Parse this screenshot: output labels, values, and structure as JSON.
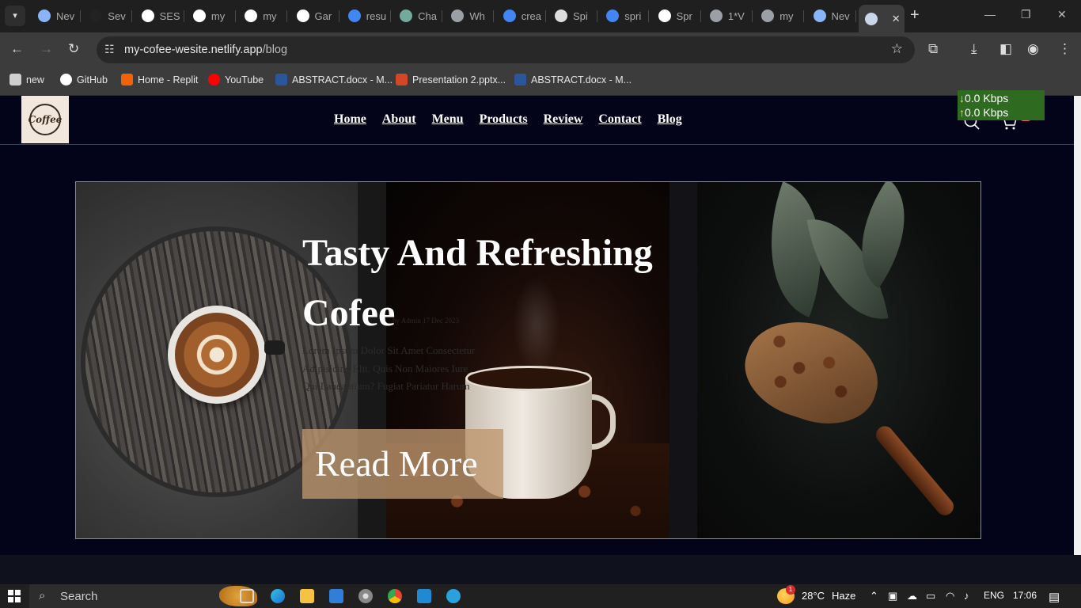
{
  "browser": {
    "tabs": [
      {
        "label": "Nev",
        "favicon_color": "#8ab4f8"
      },
      {
        "label": "Sev",
        "favicon_color": "#222222"
      },
      {
        "label": "SES",
        "favicon_color": "#ffffff"
      },
      {
        "label": "my",
        "favicon_color": "#ffffff"
      },
      {
        "label": "my",
        "favicon_color": "#ffffff"
      },
      {
        "label": "Gar",
        "favicon_color": "#ffffff"
      },
      {
        "label": "resu",
        "favicon_color": "#4285f4"
      },
      {
        "label": "Cha",
        "favicon_color": "#74aa9c"
      },
      {
        "label": "Wh",
        "favicon_color": "#9aa0a6"
      },
      {
        "label": "crea",
        "favicon_color": "#4285f4"
      },
      {
        "label": "Spi",
        "favicon_color": "#dddddd"
      },
      {
        "label": "spri",
        "favicon_color": "#4285f4"
      },
      {
        "label": "Spr",
        "favicon_color": "#ffffff"
      },
      {
        "label": "1*V",
        "favicon_color": "#9aa0a6"
      },
      {
        "label": "my",
        "favicon_color": "#9aa0a6"
      },
      {
        "label": "Nev",
        "favicon_color": "#8ab4f8"
      },
      {
        "label": "",
        "favicon_color": "#c9d7e8",
        "active": true
      }
    ],
    "new_tab_icon": "+",
    "url_host": "my-cofee-wesite.netlify.app",
    "url_path": "/blog",
    "bookmarks": [
      {
        "label": "new",
        "icon": "folder-icon",
        "color": "#cfcfcf"
      },
      {
        "label": "GitHub",
        "icon": "github-icon",
        "color": "#ffffff"
      },
      {
        "label": "Home - Replit",
        "icon": "replit-icon",
        "color": "#f26207"
      },
      {
        "label": "YouTube",
        "icon": "youtube-icon",
        "color": "#ff0000"
      },
      {
        "label": "ABSTRACT.docx - M...",
        "icon": "word-icon",
        "color": "#2b579a"
      },
      {
        "label": "Presentation 2.pptx...",
        "icon": "powerpoint-icon",
        "color": "#d24726"
      },
      {
        "label": "ABSTRACT.docx - M...",
        "icon": "word-icon",
        "color": "#2b579a"
      }
    ]
  },
  "site": {
    "logo_text": "Coffee",
    "nav": [
      "Home",
      "About",
      "Menu",
      "Products",
      "Review",
      "Contact",
      "Blog"
    ],
    "cart_count": "0",
    "hero": {
      "title": "Tasty And Refreshing Cofee",
      "meta": "by Admin 17 Dec 2023",
      "text": "Lorem Ipsum Dolor Sit Amet Consectetur Adipisicing Elit. Quis Non Maiores Iure Qui Laudantium? Fugiat Pariatur Harum",
      "button": "Read More"
    }
  },
  "speed_meter": {
    "down": "0.0 Kbps",
    "up": "0.0 Kbps",
    "background": "#2e6a1f"
  },
  "taskbar": {
    "search_placeholder": "Search",
    "weather_badge": "1",
    "temperature": "28°C",
    "weather": "Haze",
    "language": "ENG",
    "time": "17:06"
  },
  "colors": {
    "page_bg": "#03031a",
    "button_bg": "#be966e",
    "badge": "#e26b6b"
  }
}
